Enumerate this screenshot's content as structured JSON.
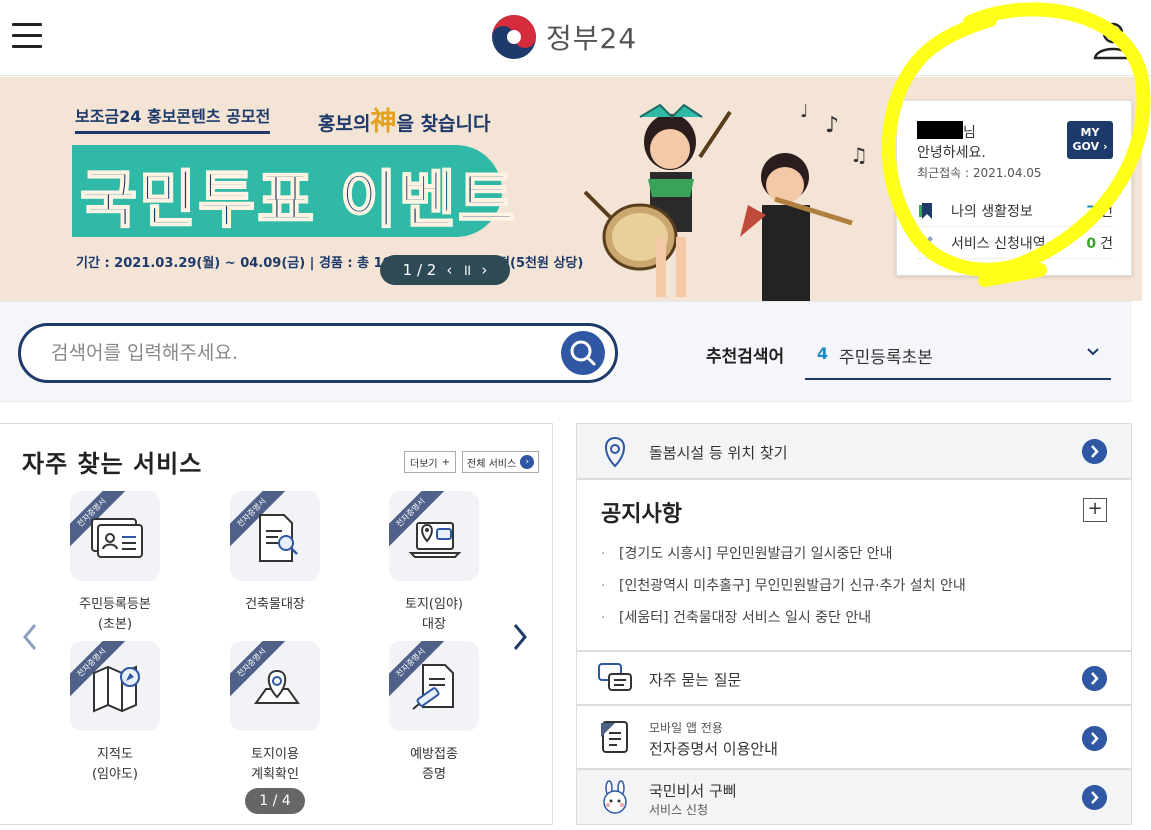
{
  "header": {
    "logo_text": "정부24"
  },
  "banner": {
    "tag1": "보조금24 홍보콘텐츠 공모전",
    "tag2_pre": "홍보의",
    "tag2_god": "神",
    "tag2_post": "을 찾습니다",
    "title": "국민투표 이벤트",
    "period": "기간 : 2021.03.29(월) ~ 04.09(금) | 경품 : 총 100분께 커피 쿠폰 증정(5천원 상당)",
    "pager": "1 / 2"
  },
  "mycard": {
    "nim": "님",
    "greeting": "안녕하세요.",
    "last_access": "최근접속 : 2021.04.05",
    "mygov_line1": "MY",
    "mygov_line2": "GOV ›",
    "rows": [
      {
        "label": "나의 생활정보",
        "count": "7",
        "unit": "건"
      },
      {
        "label": "서비스 신청내역",
        "count": "0",
        "unit": "건"
      }
    ]
  },
  "search": {
    "placeholder": "검색어를 입력해주세요.",
    "rec_label": "추천검색어",
    "rec_num": "4",
    "rec_value": "주민등록초본"
  },
  "freq": {
    "title": "자주 찾는 서비스",
    "more": "더보기",
    "all": "전체 서비스",
    "ribbon": "전자증명서",
    "items": [
      {
        "l1": "주민등록등본",
        "l2": "(초본)"
      },
      {
        "l1": "건축물대장",
        "l2": ""
      },
      {
        "l1": "토지(임야)",
        "l2": "대장"
      },
      {
        "l1": "지적도",
        "l2": "(임야도)"
      },
      {
        "l1": "토지이용",
        "l2": "계획확인"
      },
      {
        "l1": "예방접종",
        "l2": "증명"
      }
    ],
    "page": "1 / 4"
  },
  "right": {
    "location": "돌봄시설 등 위치 찾기",
    "notice_title": "공지사항",
    "notices": [
      "[경기도 시흥시] 무인민원발급기 일시중단 안내",
      "[인천광역시 미추홀구] 무인민원발급기 신규·추가 설치 안내",
      "[세움터] 건축물대장 서비스 일시 중단 안내"
    ],
    "faq": "자주 묻는 질문",
    "mobile_small": "모바일 앱 전용",
    "mobile_main": "전자증명서 이용안내",
    "bbi_main": "국민비서 구삐",
    "bbi_small": "서비스 신청"
  },
  "colors": {
    "navy": "#1e3a6b",
    "blue": "#2f57a4",
    "teal": "#2fb9a6",
    "annotation": "#ffff00"
  }
}
